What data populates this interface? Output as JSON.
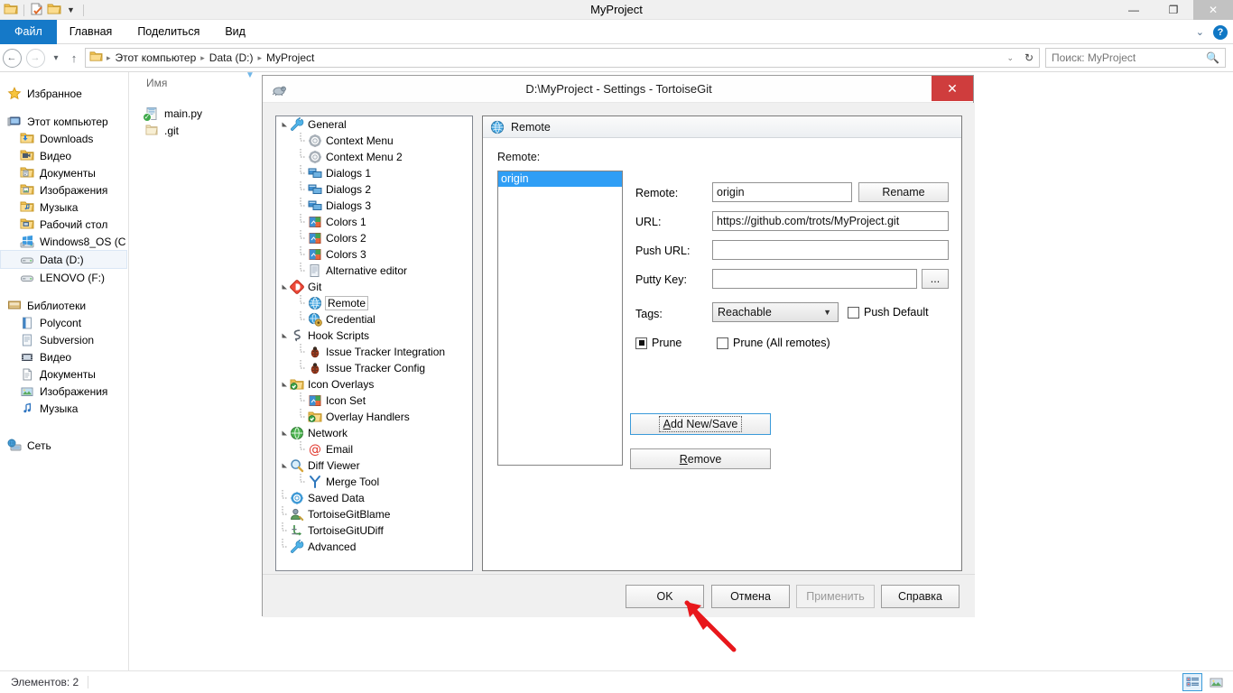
{
  "explorer": {
    "window_title": "MyProject",
    "quick_access": [
      "folder-icon",
      "new-folder-properties-icon",
      "folder-icon",
      "dropdown-caret-icon"
    ],
    "window_buttons": {
      "minimize": "—",
      "restore": "❐",
      "close": "✕"
    },
    "ribbon_tabs": [
      {
        "label": "Файл",
        "active": true
      },
      {
        "label": "Главная",
        "active": false
      },
      {
        "label": "Поделиться",
        "active": false
      },
      {
        "label": "Вид",
        "active": false
      }
    ],
    "ribbon_right": {
      "collapse": "⌄",
      "help": "?"
    },
    "address": {
      "back": "←",
      "forward": "→",
      "recent": "▾",
      "up": "↑",
      "crumbs": [
        "Этот компьютер",
        "Data (D:)",
        "MyProject"
      ],
      "crumb_sep": "▸",
      "dropdown": "⌄",
      "refresh": "↻"
    },
    "search": {
      "placeholder": "Поиск: MyProject",
      "icon": "search-icon"
    },
    "nav_groups": [
      {
        "header": {
          "label": "Избранное",
          "icon": "star-icon"
        },
        "items": []
      },
      {
        "header": {
          "label": "Этот компьютер",
          "icon": "computer-icon"
        },
        "items": [
          {
            "label": "Downloads",
            "icon": "downloads-folder-icon",
            "selected": false
          },
          {
            "label": "Видео",
            "icon": "video-folder-icon",
            "selected": false
          },
          {
            "label": "Документы",
            "icon": "documents-folder-icon",
            "selected": false
          },
          {
            "label": "Изображения",
            "icon": "pictures-folder-icon",
            "selected": false
          },
          {
            "label": "Музыка",
            "icon": "music-folder-icon",
            "selected": false
          },
          {
            "label": "Рабочий стол",
            "icon": "desktop-folder-icon",
            "selected": false
          },
          {
            "label": "Windows8_OS (C",
            "icon": "windows-drive-icon",
            "selected": false
          },
          {
            "label": "Data (D:)",
            "icon": "drive-icon",
            "selected": true
          },
          {
            "label": "LENOVO (F:)",
            "icon": "drive-icon",
            "selected": false
          }
        ]
      },
      {
        "header": {
          "label": "Библиотеки",
          "icon": "libraries-icon"
        },
        "items": [
          {
            "label": "Polycont",
            "icon": "library-icon",
            "selected": false
          },
          {
            "label": "Subversion",
            "icon": "library-icon",
            "selected": false
          },
          {
            "label": "Видео",
            "icon": "video-library-icon",
            "selected": false
          },
          {
            "label": "Документы",
            "icon": "documents-library-icon",
            "selected": false
          },
          {
            "label": "Изображения",
            "icon": "pictures-library-icon",
            "selected": false
          },
          {
            "label": "Музыка",
            "icon": "music-library-icon",
            "selected": false
          }
        ]
      },
      {
        "header": {
          "label": "Сеть",
          "icon": "network-icon"
        },
        "items": []
      }
    ],
    "column_header": "Имя",
    "files": [
      {
        "name": "main.py",
        "icon": "python-file-icon",
        "overlay": "git-normal-overlay-icon"
      },
      {
        "name": ".git",
        "icon": "folder-icon",
        "overlay": ""
      }
    ],
    "status": {
      "text": "Элементов: 2"
    },
    "view_buttons": [
      {
        "name": "details-view-button",
        "icon": "details-view-icon",
        "active": true
      },
      {
        "name": "large-icons-view-button",
        "icon": "large-icons-view-icon",
        "active": false
      }
    ]
  },
  "dialog": {
    "title": "D:\\MyProject - Settings - TortoiseGit",
    "icon": "tortoisegit-icon",
    "close_label": "✕",
    "tree": [
      {
        "label": "General",
        "level": 0,
        "icon": "wrench-icon",
        "expander": "open",
        "selected": false
      },
      {
        "label": "Context Menu",
        "level": 1,
        "icon": "gear-icon",
        "expander": "",
        "selected": false
      },
      {
        "label": "Context Menu 2",
        "level": 1,
        "icon": "gear-icon",
        "expander": "",
        "selected": false
      },
      {
        "label": "Dialogs 1",
        "level": 1,
        "icon": "dialogs-icon",
        "expander": "",
        "selected": false
      },
      {
        "label": "Dialogs 2",
        "level": 1,
        "icon": "dialogs-icon",
        "expander": "",
        "selected": false
      },
      {
        "label": "Dialogs 3",
        "level": 1,
        "icon": "dialogs-icon",
        "expander": "",
        "selected": false
      },
      {
        "label": "Colors 1",
        "level": 1,
        "icon": "colors-icon",
        "expander": "",
        "selected": false
      },
      {
        "label": "Colors 2",
        "level": 1,
        "icon": "colors-icon",
        "expander": "",
        "selected": false
      },
      {
        "label": "Colors 3",
        "level": 1,
        "icon": "colors-icon",
        "expander": "",
        "selected": false
      },
      {
        "label": "Alternative editor",
        "level": 1,
        "icon": "editor-icon",
        "expander": "",
        "selected": false
      },
      {
        "label": "Git",
        "level": 0,
        "icon": "git-icon",
        "expander": "open",
        "selected": false
      },
      {
        "label": "Remote",
        "level": 1,
        "icon": "globe-icon",
        "expander": "",
        "selected": true
      },
      {
        "label": "Credential",
        "level": 1,
        "icon": "credential-icon",
        "expander": "",
        "selected": false
      },
      {
        "label": "Hook Scripts",
        "level": 0,
        "icon": "hook-icon",
        "expander": "open",
        "selected": false
      },
      {
        "label": "Issue Tracker Integration",
        "level": 1,
        "icon": "bug-icon",
        "expander": "",
        "selected": false
      },
      {
        "label": "Issue Tracker Config",
        "level": 1,
        "icon": "bug-icon",
        "expander": "",
        "selected": false
      },
      {
        "label": "Icon Overlays",
        "level": 0,
        "icon": "overlay-folder-icon",
        "expander": "open",
        "selected": false
      },
      {
        "label": "Icon Set",
        "level": 1,
        "icon": "colors-icon",
        "expander": "",
        "selected": false
      },
      {
        "label": "Overlay Handlers",
        "level": 1,
        "icon": "overlay-folder-icon",
        "expander": "",
        "selected": false
      },
      {
        "label": "Network",
        "level": 0,
        "icon": "green-globe-icon",
        "expander": "open",
        "selected": false
      },
      {
        "label": "Email",
        "level": 1,
        "icon": "at-sign-icon",
        "expander": "",
        "selected": false
      },
      {
        "label": "Diff Viewer",
        "level": 0,
        "icon": "magnifier-icon",
        "expander": "open",
        "selected": false
      },
      {
        "label": "Merge Tool",
        "level": 1,
        "icon": "merge-icon",
        "expander": "",
        "selected": false
      },
      {
        "label": "Saved Data",
        "level": 0,
        "icon": "saved-data-icon",
        "expander": "",
        "selected": false
      },
      {
        "label": "TortoiseGitBlame",
        "level": 0,
        "icon": "blame-icon",
        "expander": "",
        "selected": false
      },
      {
        "label": "TortoiseGitUDiff",
        "level": 0,
        "icon": "udiff-icon",
        "expander": "",
        "selected": false
      },
      {
        "label": "Advanced",
        "level": 0,
        "icon": "wrench-icon",
        "expander": "",
        "selected": false
      }
    ],
    "panel": {
      "header": {
        "title": "Remote",
        "icon": "globe-icon"
      },
      "remote_list_label": "Remote:",
      "remote_list": [
        {
          "label": "origin",
          "selected": true
        }
      ],
      "fields": {
        "remote_label": "Remote:",
        "remote_value": "origin",
        "rename_button": "Rename",
        "url_label": "URL:",
        "url_value": "https://github.com/trots/MyProject.git",
        "push_url_label": "Push URL:",
        "push_url_value": "",
        "putty_key_label": "Putty Key:",
        "putty_key_value": "",
        "browse_button": "...",
        "tags_label": "Tags:",
        "tags_value": "Reachable",
        "push_default_label": "Push Default",
        "push_default_checked": false,
        "prune_label": "Prune",
        "prune_state": "indeterminate",
        "prune_all_label": "Prune (All remotes)",
        "prune_all_checked": false
      },
      "actions": {
        "add_new_save": "Add New/Save",
        "add_new_save_accel": "A",
        "remove": "Remove",
        "remove_accel": "R"
      }
    },
    "footer_buttons": [
      {
        "label": "OK",
        "name": "ok-button",
        "disabled": false
      },
      {
        "label": "Отмена",
        "name": "cancel-button",
        "disabled": false
      },
      {
        "label": "Применить",
        "name": "apply-button",
        "disabled": true
      },
      {
        "label": "Справка",
        "name": "help-button",
        "disabled": false
      }
    ]
  },
  "annotation": {
    "arrow_color": "#e8171b",
    "points_to": "ok-button"
  },
  "colors": {
    "accent_blue": "#1579c8",
    "selection_blue": "#2f9ef5",
    "close_red": "#cf3d3d",
    "dialog_bg": "#f0f0f0",
    "arrow_red": "#e8171b"
  }
}
